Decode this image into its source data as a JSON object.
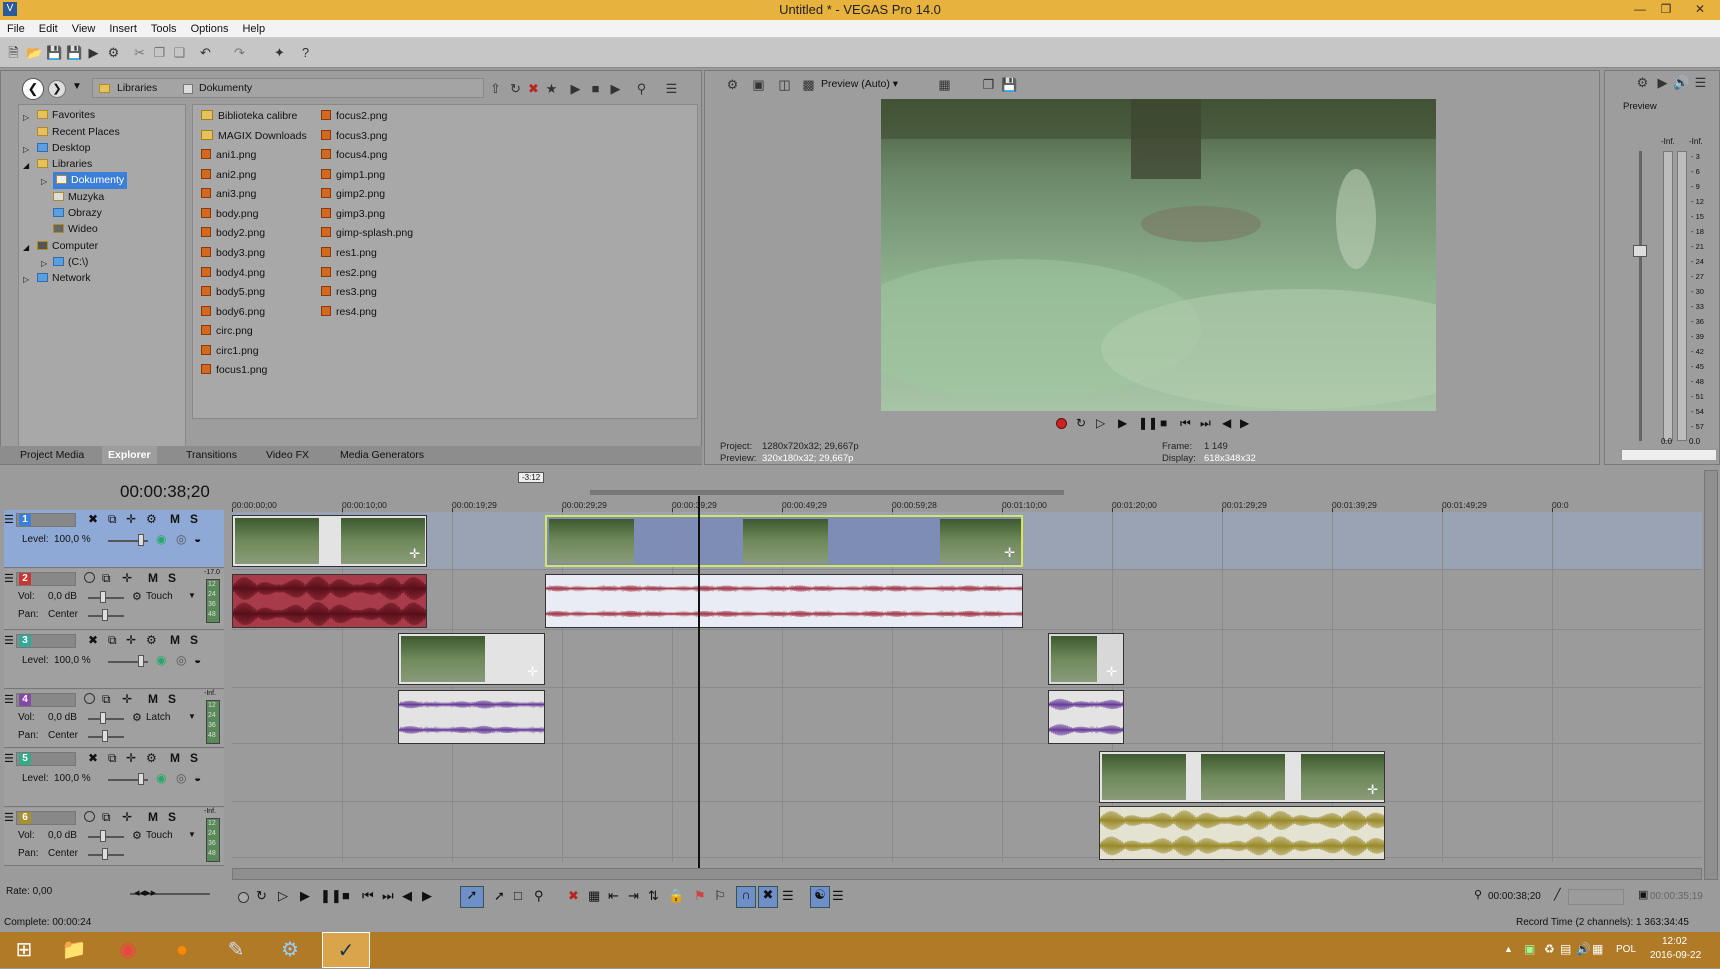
{
  "window": {
    "title": "Untitled * - VEGAS Pro 14.0"
  },
  "menu": [
    "File",
    "Edit",
    "View",
    "Insert",
    "Tools",
    "Options",
    "Help"
  ],
  "explorer": {
    "path": [
      "Libraries",
      "Dokumenty"
    ],
    "tree": [
      {
        "label": "Favorites",
        "level": 1
      },
      {
        "label": "Recent Places",
        "level": 1
      },
      {
        "label": "Desktop",
        "level": 1
      },
      {
        "label": "Libraries",
        "level": 1
      },
      {
        "label": "Dokumenty",
        "level": 2,
        "selected": true
      },
      {
        "label": "Muzyka",
        "level": 2
      },
      {
        "label": "Obrazy",
        "level": 2
      },
      {
        "label": "Wideo",
        "level": 2
      },
      {
        "label": "Computer",
        "level": 1
      },
      {
        "label": "(C:\\)",
        "level": 2
      },
      {
        "label": "Network",
        "level": 1
      }
    ],
    "files_col1": [
      "Biblioteka calibre",
      "MAGIX Downloads",
      "ani1.png",
      "ani2.png",
      "ani3.png",
      "body.png",
      "body2.png",
      "body3.png",
      "body4.png",
      "body5.png",
      "body6.png",
      "circ.png",
      "circ1.png",
      "focus1.png"
    ],
    "files_col2": [
      "focus2.png",
      "focus3.png",
      "focus4.png",
      "gimp1.png",
      "gimp2.png",
      "gimp3.png",
      "gimp-splash.png",
      "res1.png",
      "res2.png",
      "res3.png",
      "res4.png"
    ],
    "tabs": [
      "Project Media",
      "Explorer",
      "Transitions",
      "Video FX",
      "Media Generators"
    ]
  },
  "preview": {
    "mode": "Preview (Auto)",
    "project_label": "Project:",
    "project_value": "1280x720x32; 29,667p",
    "preview_label": "Preview:",
    "preview_value": "320x180x32; 29,667p",
    "frame_label": "Frame:",
    "frame_value": "1 149",
    "display_label": "Display:",
    "display_value": "618x348x32"
  },
  "master": {
    "label": "Preview",
    "inf_l": "-Inf.",
    "inf_r": "-Inf.",
    "scale": [
      "3",
      "6",
      "9",
      "12",
      "15",
      "18",
      "21",
      "24",
      "27",
      "30",
      "33",
      "36",
      "39",
      "42",
      "45",
      "48",
      "51",
      "54",
      "57"
    ],
    "bottom_l": "0.0",
    "bottom_r": "0.0"
  },
  "timeline": {
    "timecode": "00:00:38;20",
    "ruler": [
      "00:00:00;00",
      "00:00:10;00",
      "00:00:19;29",
      "00:00:29;29",
      "00:00:39;29",
      "00:00:49;29",
      "00:00:59;28",
      "00:01:10;00",
      "00:01:20;00",
      "00:01:29;29",
      "00:01:39;29",
      "00:01:49;29",
      "00:0"
    ],
    "marker_label": "-3:12",
    "tracks": [
      {
        "num": "1",
        "type": "video",
        "level_label": "Level:",
        "level": "100,0 %"
      },
      {
        "num": "2",
        "type": "audio",
        "vol_label": "Vol:",
        "vol": "0,0 dB",
        "pan_label": "Pan:",
        "pan": "Center",
        "mode": "Touch",
        "meter": "-17.0"
      },
      {
        "num": "3",
        "type": "video",
        "level_label": "Level:",
        "level": "100,0 %"
      },
      {
        "num": "4",
        "type": "audio",
        "vol_label": "Vol:",
        "vol": "0,0 dB",
        "pan_label": "Pan:",
        "pan": "Center",
        "mode": "Latch",
        "meter": "-Inf."
      },
      {
        "num": "5",
        "type": "video",
        "level_label": "Level:",
        "level": "100,0 %"
      },
      {
        "num": "6",
        "type": "audio",
        "vol_label": "Vol:",
        "vol": "0,0 dB",
        "pan_label": "Pan:",
        "pan": "Center",
        "mode": "Touch",
        "meter": "-Inf."
      }
    ],
    "meter_ticks": [
      "12",
      "24",
      "36",
      "48"
    ],
    "rate": "Rate: 0,00",
    "cursor_time": "00:00:38;20",
    "end_time": "00:00:35;19"
  },
  "status": {
    "left": "Complete: 00:00:24",
    "right": "Record Time (2 channels): 1 363:34:45"
  },
  "taskbar": {
    "lang": "POL",
    "time": "12:02",
    "date": "2016-09-22"
  }
}
